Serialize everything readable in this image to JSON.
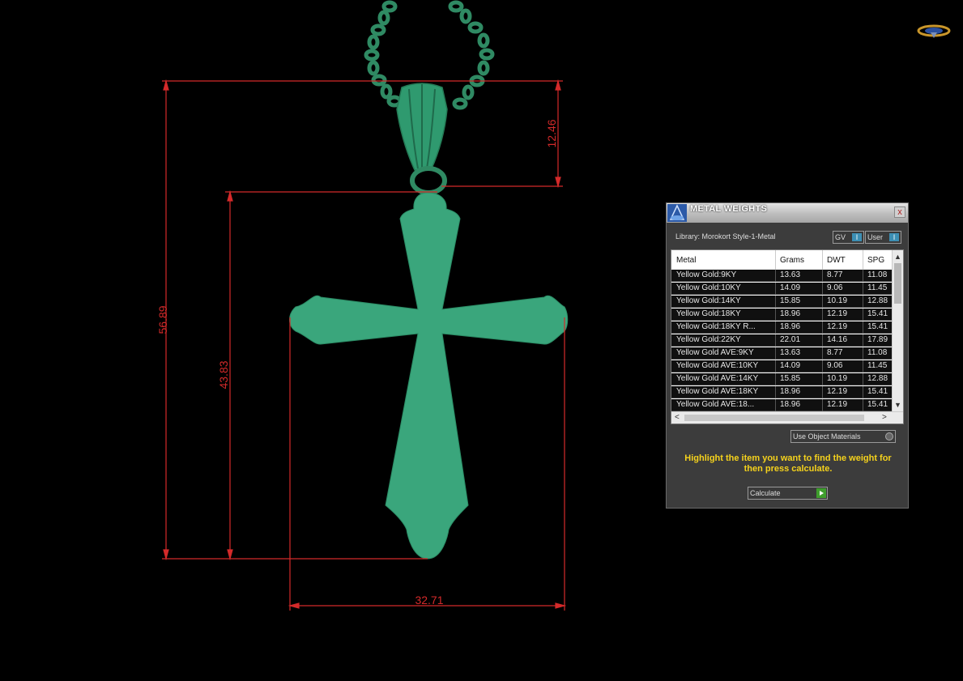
{
  "viewport": {
    "dimensions": [
      {
        "label": "56.89"
      },
      {
        "label": "43.83"
      },
      {
        "label": "12.46"
      },
      {
        "label": "32.71"
      }
    ],
    "model_color": "#3aa67c",
    "dimension_color": "#d42a2a"
  },
  "dialog": {
    "title": "METAL WEIGHTS",
    "close": "x",
    "library": "Library: Morokort Style-1-Metal",
    "toggle_gv": "GV",
    "toggle_user": "User",
    "toggle_knob": "I",
    "table": {
      "headers": [
        "Metal",
        "Grams",
        "DWT",
        "SPG"
      ],
      "rows": [
        [
          "Yellow Gold:9KY",
          "13.63",
          "8.77",
          "11.08"
        ],
        [
          "Yellow Gold:10KY",
          "14.09",
          "9.06",
          "11.45"
        ],
        [
          "Yellow Gold:14KY",
          "15.85",
          "10.19",
          "12.88"
        ],
        [
          "Yellow Gold:18KY",
          "18.96",
          "12.19",
          "15.41"
        ],
        [
          "Yellow Gold:18KY R...",
          "18.96",
          "12.19",
          "15.41"
        ],
        [
          "Yellow Gold:22KY",
          "22.01",
          "14.16",
          "17.89"
        ],
        [
          "Yellow Gold AVE:9KY",
          "13.63",
          "8.77",
          "11.08"
        ],
        [
          "Yellow Gold AVE:10KY",
          "14.09",
          "9.06",
          "11.45"
        ],
        [
          "Yellow Gold AVE:14KY",
          "15.85",
          "10.19",
          "12.88"
        ],
        [
          "Yellow Gold AVE:18KY",
          "18.96",
          "12.19",
          "15.41"
        ],
        [
          "Yellow Gold AVE:18...",
          "18.96",
          "12.19",
          "15.41"
        ]
      ]
    },
    "use_object_materials": "Use Object Materials",
    "hint": "Highlight the item you want to find the weight for then press calculate.",
    "calculate": "Calculate",
    "colors": {
      "hint": "#f5d21c",
      "knob": "#3c8fb4",
      "go": "#3f9e2d"
    }
  }
}
